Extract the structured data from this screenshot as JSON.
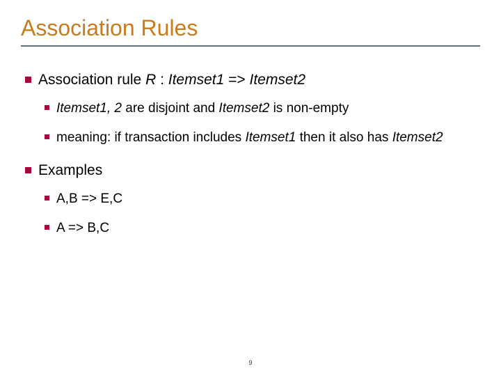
{
  "title": "Association Rules",
  "b1": {
    "prefix": "Association rule ",
    "r": "R",
    "colon": " : ",
    "i1": "Itemset1",
    "arrow": " => ",
    "i2": "Itemset2"
  },
  "b1a": {
    "i12": "Itemset1, 2",
    "mid": " are disjoint and ",
    "i2": "Itemset2",
    "tail": " is non-empty"
  },
  "b1b": {
    "prefix": "meaning: if transaction includes ",
    "i1": "Itemset1",
    "mid": " then it also has ",
    "i2": "Itemset2"
  },
  "b2": {
    "label": "Examples"
  },
  "b2a": {
    "label": "A,B => E,C"
  },
  "b2b": {
    "label": "A => B,C"
  },
  "page": "9"
}
